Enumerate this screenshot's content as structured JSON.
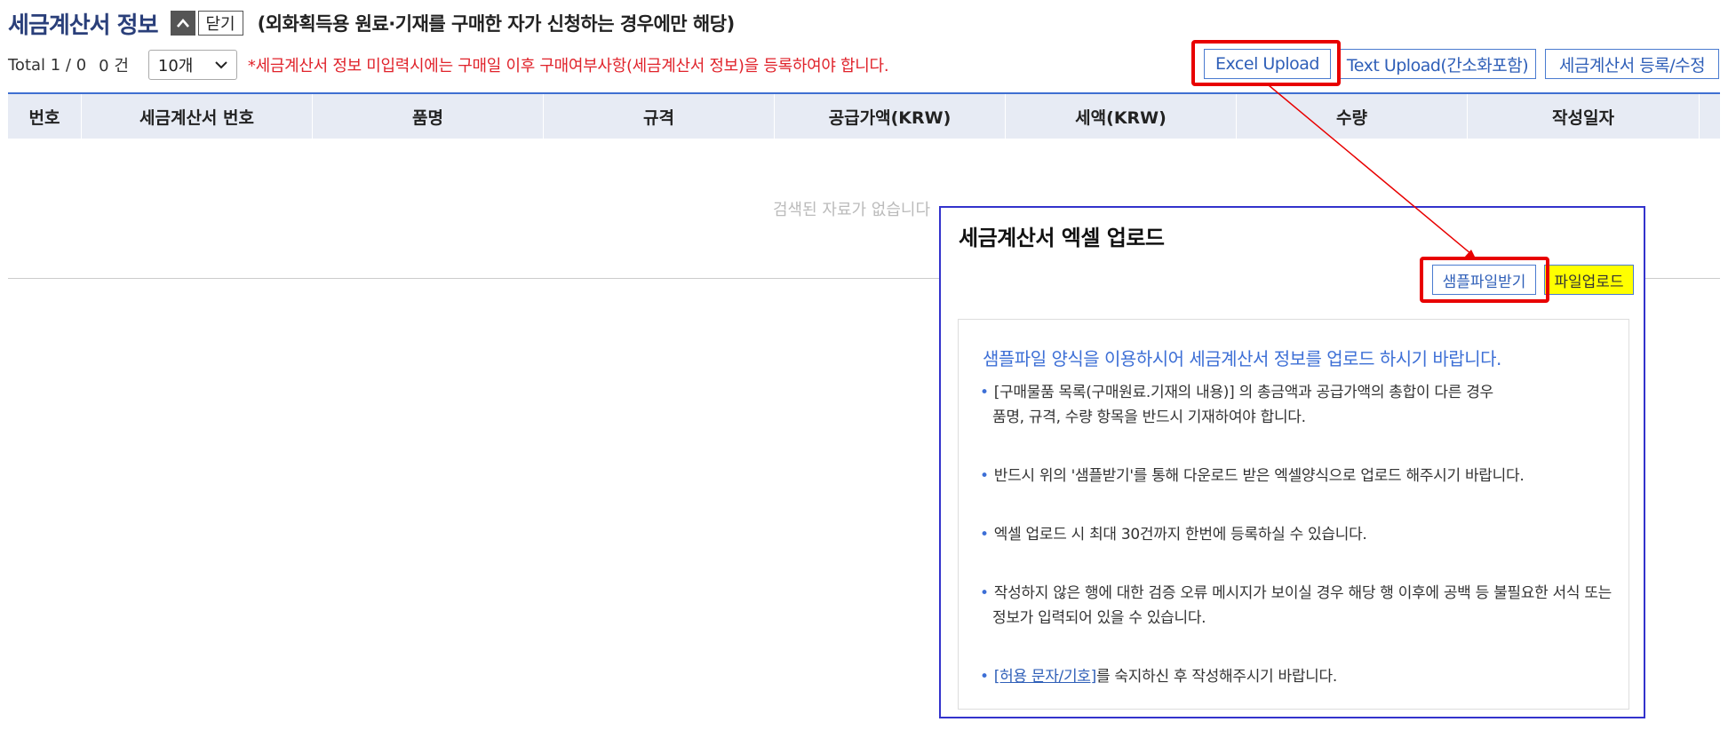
{
  "header": {
    "title": "세금계산서 정보",
    "toggle_icon": "^",
    "close_label": "닫기",
    "note": "(외화획득용 원료·기재를 구매한 자가 신청하는 경우에만 해당)"
  },
  "info": {
    "total": "Total 1 / 0",
    "count": "0 건",
    "page_size": "10개",
    "warning": "*세금계산서 정보 미입력시에는 구매일 이후 구매여부사항(세금계산서 정보)을 등록하여야 합니다."
  },
  "buttons": {
    "excel_upload": "Excel Upload",
    "text_upload": "Text Upload(간소화포함)",
    "register_edit": "세금계산서 등록/수정"
  },
  "table": {
    "columns": [
      "번호",
      "세금계산서 번호",
      "품명",
      "규격",
      "공급가액(KRW)",
      "세액(KRW)",
      "수량",
      "작성일자"
    ],
    "empty_message": "검색된 자료가 없습니다"
  },
  "modal": {
    "title": "세금계산서 엑셀 업로드",
    "sample_button": "샘플파일받기",
    "upload_button": "파일업로드",
    "guide_heading": "샘플파일 양식을 이용하시어 세금계산서 정보를 업로드 하시기 바랍니다.",
    "guide_1_line1": "[구매물품 목록(구매원료.기재의 내용)] 의 총금액과 공급가액의 총합이 다른 경우",
    "guide_1_line2": "품명, 규격, 수량 항목을 반드시 기재하여야 합니다.",
    "guide_2": "반드시 위의 '샘플받기'를 통해 다운로드 받은 엑셀양식으로 업로드 해주시기 바랍니다.",
    "guide_3": "엑셀 업로드 시 최대 30건까지 한번에 등록하실 수 있습니다.",
    "guide_4_line1": "작성하지 않은 행에 대한 검증 오류 메시지가 보이실 경우 해당 행 이후에 공백 등 불필요한 서식 또는",
    "guide_4_line2": "정보가 입력되어 있을 수 있습니다.",
    "guide_5_link": "[허용 문자/기호]",
    "guide_5_text": "를 숙지하신 후 작성해주시기 바랍니다."
  },
  "colors": {
    "accent": "#3f6fd1",
    "warning": "#e0232b",
    "highlight_box": "#e80000",
    "upload_highlight": "#ffff00"
  }
}
